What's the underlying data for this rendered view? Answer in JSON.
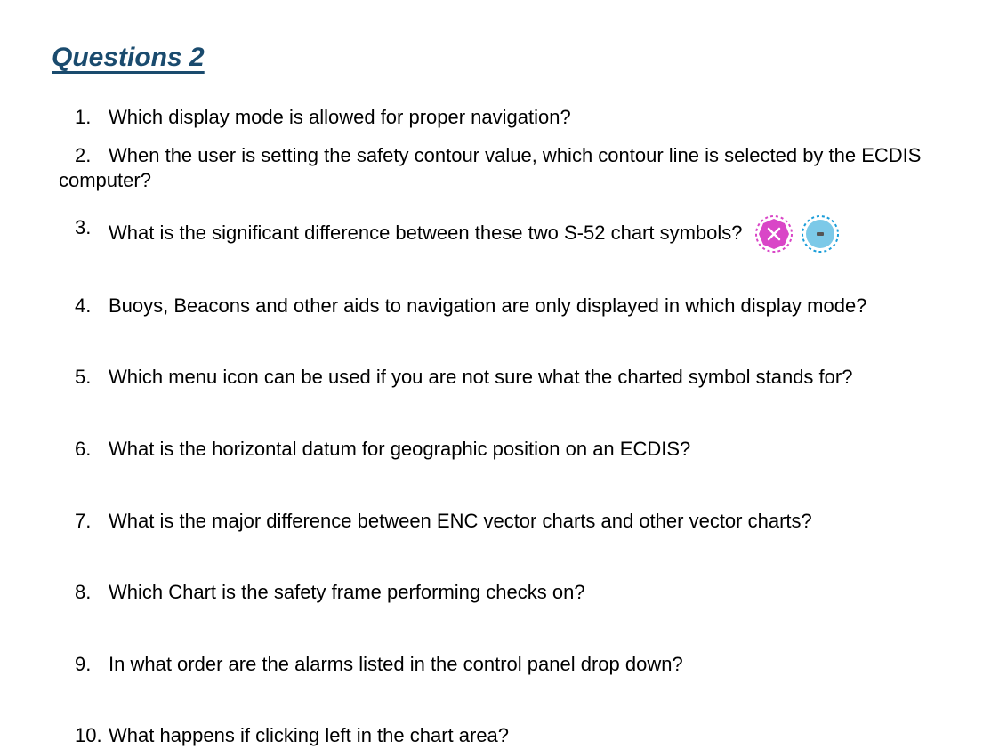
{
  "title": "Questions 2",
  "questions": [
    {
      "num": "1.",
      "text": "Which display mode is allowed for proper navigation?"
    },
    {
      "num": "2.",
      "text": "When the user is setting the safety contour value, which contour line is selected by the ECDIS computer?"
    },
    {
      "num": "3.",
      "text": "What is the significant difference between these two S-52 chart symbols?"
    },
    {
      "num": "4.",
      "text": "Buoys, Beacons and other aids to navigation are only displayed in which display mode?"
    },
    {
      "num": "5.",
      "text": "Which menu icon can be used if you are not sure what the charted symbol stands for?"
    },
    {
      "num": "6.",
      "text": "What is the horizontal datum for geographic position on an ECDIS?"
    },
    {
      "num": "7.",
      "text": "What is the major difference between ENC vector charts and other vector charts?"
    },
    {
      "num": "8.",
      "text": "Which Chart is the safety frame performing checks on?"
    },
    {
      "num": "9.",
      "text": "In what order are the alarms listed in the control panel drop down?"
    },
    {
      "num": "10.",
      "text": "What happens if clicking left in the chart area?"
    }
  ]
}
